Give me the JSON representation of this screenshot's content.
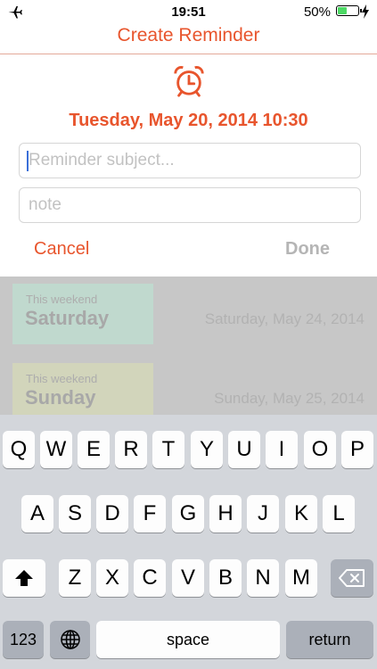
{
  "status_bar": {
    "time": "19:51",
    "battery_percent": "50%",
    "battery_level": 0.5,
    "icons": [
      "airplane-icon",
      "battery-icon",
      "charging-bolt-icon"
    ]
  },
  "header": {
    "title": "Create Reminder",
    "icon": "alarm-clock-icon"
  },
  "datetime": "Tuesday, May 20, 2014 10:30",
  "form": {
    "subject_placeholder": "Reminder subject...",
    "note_placeholder": "note"
  },
  "actions": {
    "cancel": "Cancel",
    "done": "Done"
  },
  "background_list": [
    {
      "caption": "This weekend",
      "day": "Saturday",
      "date": "Saturday, May 24, 2014",
      "color": "#c0d9ce"
    },
    {
      "caption": "This weekend",
      "day": "Sunday",
      "date": "Sunday, May 25, 2014",
      "color": "#d2d5bb"
    }
  ],
  "keyboard": {
    "row1": [
      "Q",
      "W",
      "E",
      "R",
      "T",
      "Y",
      "U",
      "I",
      "O",
      "P"
    ],
    "row2": [
      "A",
      "S",
      "D",
      "F",
      "G",
      "H",
      "J",
      "K",
      "L"
    ],
    "row3": [
      "Z",
      "X",
      "C",
      "V",
      "B",
      "N",
      "M"
    ],
    "numbers": "123",
    "space": "space",
    "return": "return",
    "icons": [
      "shift-icon",
      "backspace-icon",
      "globe-icon"
    ]
  },
  "colors": {
    "accent": "#e8552d",
    "keyboard_bg": "#d3d6db",
    "caret": "#3a6fd8"
  }
}
